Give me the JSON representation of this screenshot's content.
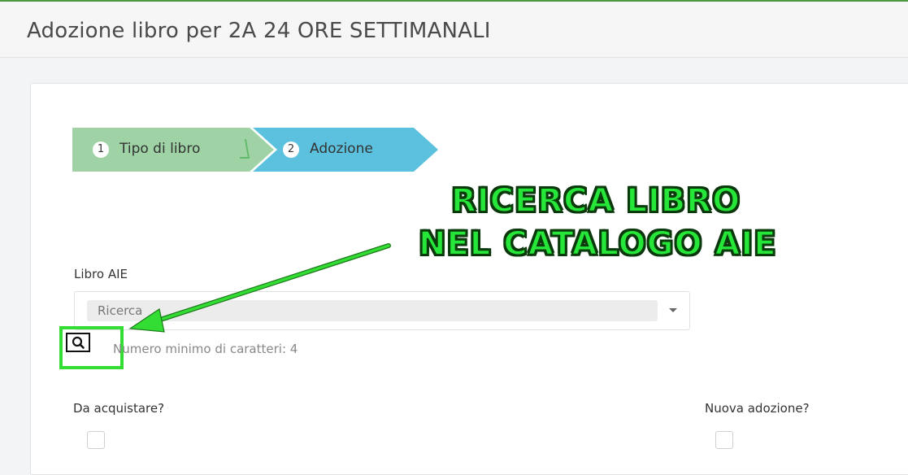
{
  "header": {
    "title": "Adozione libro per 2A 24 ORE SETTIMANALI"
  },
  "wizard": {
    "steps": [
      {
        "number": "1",
        "label": "Tipo di libro",
        "state": "done"
      },
      {
        "number": "2",
        "label": "Adozione",
        "state": "active"
      }
    ]
  },
  "annotation": {
    "line1": "RICERCA LIBRO",
    "line2": "NEL CATALOGO AIE",
    "color": "#26e63a"
  },
  "form": {
    "libro_aie": {
      "label": "Libro AIE",
      "placeholder": "Ricerca",
      "hint": "Numero minimo di caratteri: 4",
      "search_icon": "magnifier-icon"
    },
    "da_acquistare": {
      "label": "Da acquistare?",
      "checked": false
    },
    "nuova_adozione": {
      "label": "Nuova adozione?",
      "checked": false
    }
  },
  "colors": {
    "step_done": "#9fd3a6",
    "step_active": "#5cc1de",
    "accent_green": "#33dd33"
  }
}
